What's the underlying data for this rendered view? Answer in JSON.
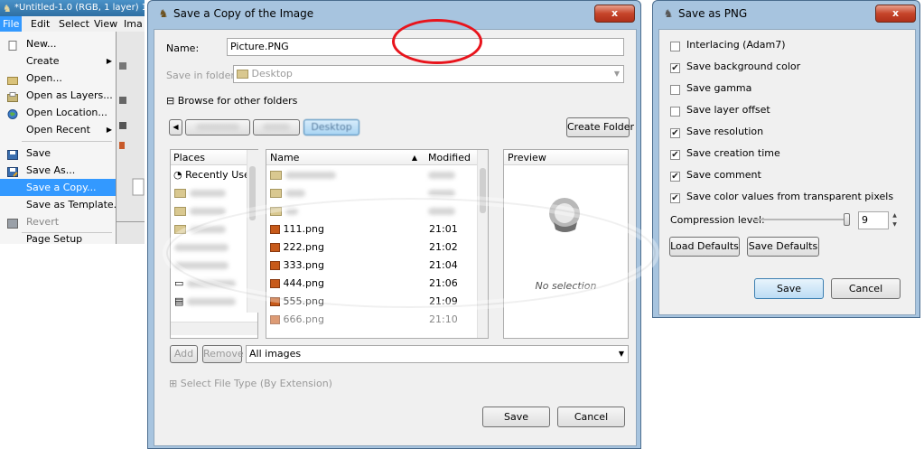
{
  "gimp_window": {
    "title": "*Untitled-1.0 (RGB, 1 layer) 1",
    "menubar": [
      "File",
      "Edit",
      "Select",
      "View",
      "Ima"
    ],
    "file_menu": {
      "items": [
        {
          "label": "New...",
          "icon": "new-file-icon"
        },
        {
          "label": "Create",
          "submenu": true
        },
        {
          "label": "Open...",
          "icon": "open-folder-icon"
        },
        {
          "label": "Open as Layers...",
          "icon": "open-layers-icon"
        },
        {
          "label": "Open Location...",
          "icon": "globe-icon"
        },
        {
          "label": "Open Recent",
          "submenu": true
        },
        {
          "label": "Save",
          "icon": "save-icon"
        },
        {
          "label": "Save As...",
          "icon": "save-as-icon"
        },
        {
          "label": "Save a Copy...",
          "highlighted": true
        },
        {
          "label": "Save as Template..."
        },
        {
          "label": "Revert",
          "icon": "revert-icon",
          "disabled": true
        },
        {
          "label": "Page Setup"
        }
      ]
    }
  },
  "save_copy_dialog": {
    "title": "Save a Copy of the Image",
    "close_label": "x",
    "name_label": "Name:",
    "name_value": "Picture.PNG",
    "save_in_label": "Save in folder:",
    "save_in_value": "Desktop",
    "browse_label": "Browse for other folders",
    "path_buttons": [
      "",
      "",
      "Desktop"
    ],
    "create_folder_label": "Create Folder",
    "places_header": "Places",
    "places": [
      {
        "label": "Recently Used",
        "icon": "clock-icon"
      }
    ],
    "columns": {
      "name": "Name",
      "modified": "Modified"
    },
    "files": [
      {
        "name": "111.png",
        "modified": "21:01"
      },
      {
        "name": "222.png",
        "modified": "21:02"
      },
      {
        "name": "333.png",
        "modified": "21:04"
      },
      {
        "name": "444.png",
        "modified": "21:06"
      },
      {
        "name": "555.png",
        "modified": "21:09"
      },
      {
        "name": "666.png",
        "modified": "21:10"
      }
    ],
    "preview_label": "Preview",
    "no_selection": "No selection",
    "add_label": "Add",
    "remove_label": "Remove",
    "filter_value": "All images",
    "file_type_label": "Select File Type (By Extension)",
    "save_label": "Save",
    "cancel_label": "Cancel"
  },
  "png_dialog": {
    "title": "Save as PNG",
    "close_label": "x",
    "options": [
      {
        "label": "Interlacing (Adam7)",
        "checked": false
      },
      {
        "label": "Save background color",
        "checked": true
      },
      {
        "label": "Save gamma",
        "checked": false
      },
      {
        "label": "Save layer offset",
        "checked": false
      },
      {
        "label": "Save resolution",
        "checked": true
      },
      {
        "label": "Save creation time",
        "checked": true
      },
      {
        "label": "Save comment",
        "checked": true
      },
      {
        "label": "Save color values from transparent pixels",
        "checked": true
      }
    ],
    "compression_label": "Compression level:",
    "compression_value": "9",
    "compression_max": 9,
    "load_defaults_label": "Load Defaults",
    "save_defaults_label": "Save Defaults",
    "save_label": "Save",
    "cancel_label": "Cancel"
  },
  "colors": {
    "title_bar": "#a7c4df",
    "highlight": "#3399ff",
    "annotation_red": "#e8141c",
    "close_button": "#c6452a"
  }
}
